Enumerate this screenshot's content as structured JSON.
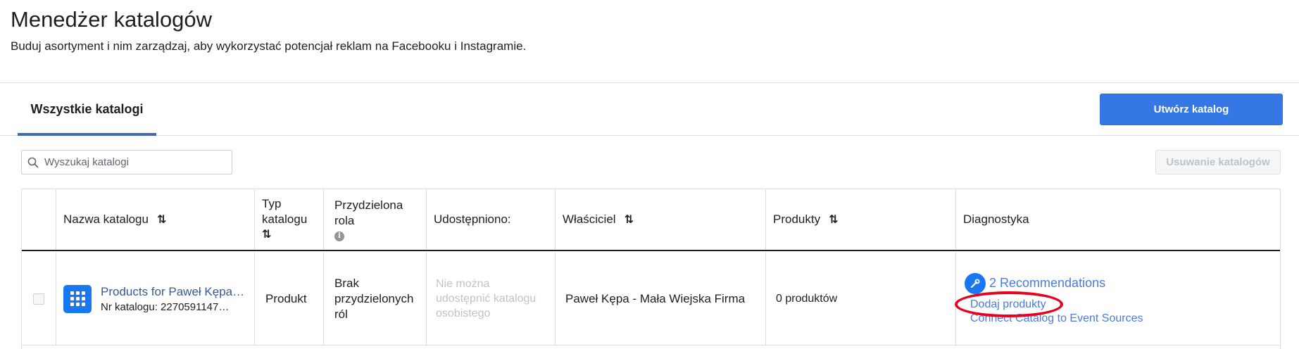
{
  "header": {
    "title": "Menedżer katalogów",
    "subtitle": "Buduj asortyment i nim zarządzaj, aby wykorzystać potencjał reklam na Facebooku i Instagramie."
  },
  "tabs": [
    {
      "label": "Wszystkie katalogi",
      "active": true
    }
  ],
  "toolbar": {
    "create_label": "Utwórz katalog",
    "delete_label": "Usuwanie katalogów",
    "search_placeholder": "Wyszukaj katalogi"
  },
  "table": {
    "columns": {
      "name": "Nazwa katalogu",
      "type_line1": "Typ",
      "type_line2": "katalogu",
      "role_line1": "Przydzielona",
      "role_line2": "rola",
      "shared": "Udostępniono:",
      "owner": "Właściciel",
      "products": "Produkty",
      "diagnostics": "Diagnostyka"
    },
    "sort_glyph": "⇅",
    "rows": [
      {
        "name": "Products for Paweł Kępa - Mała Wiejska Firma",
        "catalog_id": "Nr katalogu: 2270591147…",
        "type": "Produkt",
        "role_line1": "Brak",
        "role_line2": "przydzielonych",
        "role_line3": "ról",
        "shared_line1": "Nie można",
        "shared_line2": "udostępnić katalogu",
        "shared_line3": "osobistego",
        "owner": "Paweł Kępa - Mała Wiejska Firma",
        "products": "0 produktów",
        "recommendations": "2 Recommendations",
        "add_products": "Dodaj produkty",
        "connect": "Connect Catalog to Event Sources"
      }
    ]
  },
  "colors": {
    "primary": "#3578e5",
    "link": "#4a7be0",
    "tab_underline": "#4267b2",
    "highlight": "#e8001c"
  }
}
